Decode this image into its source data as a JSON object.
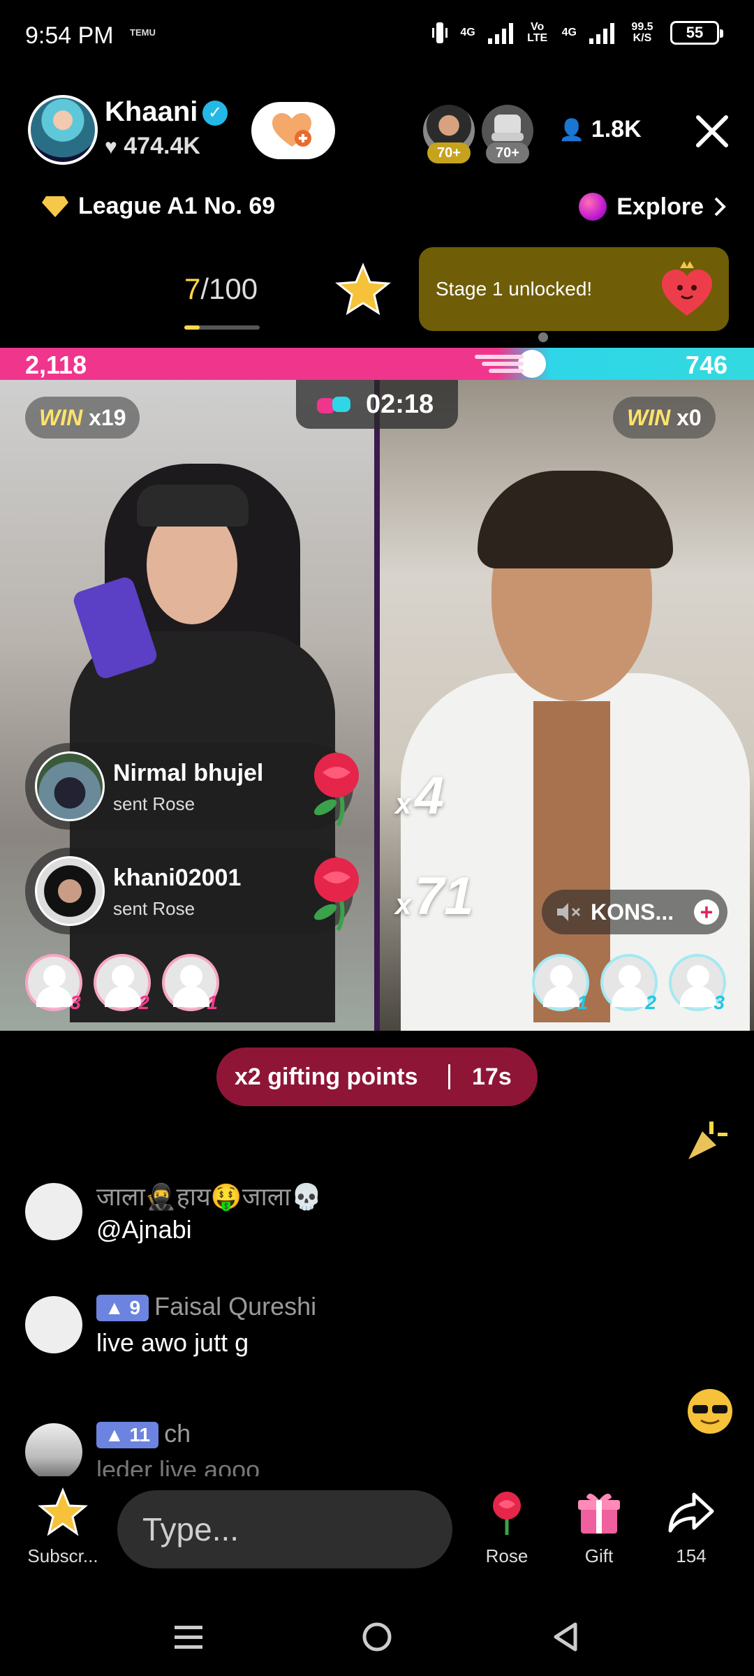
{
  "status": {
    "time": "9:54 PM",
    "small_icon_text": "TEMU",
    "net1": "4G",
    "volte": "Vo LTE",
    "net2": "4G",
    "speed": "99.5 K/S",
    "battery": "55"
  },
  "host": {
    "name": "Khaani",
    "likes": "474.4K",
    "viewer_badges": [
      "70+",
      "70+"
    ],
    "viewer_count": "1.8K"
  },
  "league": {
    "label": "League A1 No. 69",
    "explore": "Explore"
  },
  "progress": {
    "current": "7",
    "total": "/100",
    "fraction": 0.07
  },
  "stage": {
    "text": "Stage 1 unlocked!"
  },
  "battle": {
    "score_left": "2,118",
    "score_right": "746",
    "timer": "02:18",
    "win_label": "WIN",
    "left_wins": "x19",
    "right_wins": "x0"
  },
  "gifts": [
    {
      "user": "Nirmal bhujel",
      "action": "sent Rose"
    },
    {
      "user": "khani02001",
      "action": "sent Rose"
    }
  ],
  "combos": [
    {
      "x": "x",
      "n": "4"
    },
    {
      "x": "x",
      "n": "71"
    }
  ],
  "opponent": {
    "name": "KONS...",
    "plus": "+"
  },
  "slots_left": [
    "3",
    "2",
    "1"
  ],
  "slots_right": [
    "1",
    "2",
    "3"
  ],
  "multiplier": {
    "label": "x2 gifting points",
    "time": "17s"
  },
  "chat": [
    {
      "name": "जाला🥷हाय🤑जाला💀",
      "msg": "@Ajnabi",
      "level": ""
    },
    {
      "name": "Faisal Qureshi",
      "msg": "live awo jutt g",
      "level": "9"
    },
    {
      "name": "ch",
      "msg": "leder live aooo",
      "level": "11"
    }
  ],
  "bottom": {
    "subscribe": "Subscr...",
    "type_placeholder": "Type...",
    "rose": "Rose",
    "gift": "Gift",
    "share_count": "154"
  },
  "colors": {
    "pink": "#f0358d",
    "cyan": "#2ed6e8",
    "stage_bg": "#6f5d08",
    "multiplier_bg": "#8f1537"
  }
}
